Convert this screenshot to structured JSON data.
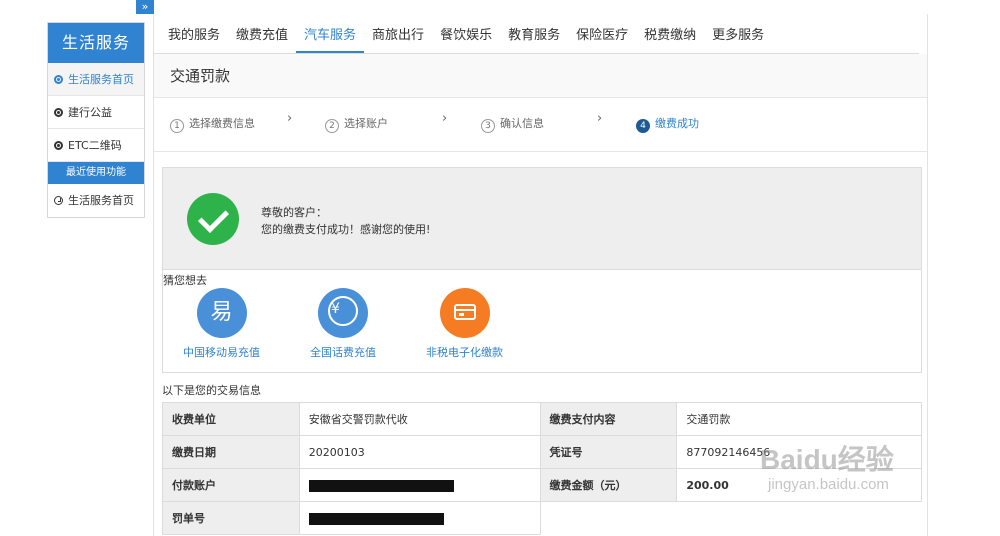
{
  "expand_toggle": "»",
  "sidebar": {
    "title": "生活服务",
    "items": [
      {
        "label": "生活服务首页",
        "icon": "dot-circle-icon",
        "active": true
      },
      {
        "label": "建行公益",
        "icon": "dot-circle-icon",
        "active": false
      },
      {
        "label": "ETC二维码",
        "icon": "dot-circle-icon",
        "active": false
      }
    ],
    "recent_header": "最近使用功能",
    "recent_items": [
      {
        "label": "生活服务首页",
        "icon": "clock-icon"
      }
    ]
  },
  "tabs": [
    {
      "label": "我的服务",
      "active": false
    },
    {
      "label": "缴费充值",
      "active": false
    },
    {
      "label": "汽车服务",
      "active": true
    },
    {
      "label": "商旅出行",
      "active": false
    },
    {
      "label": "餐饮娱乐",
      "active": false
    },
    {
      "label": "教育服务",
      "active": false
    },
    {
      "label": "保险医疗",
      "active": false
    },
    {
      "label": "税费缴纳",
      "active": false
    },
    {
      "label": "更多服务",
      "active": false
    }
  ],
  "page_title": "交通罚款",
  "steps": [
    {
      "num": "1",
      "label": "选择缴费信息",
      "current": false
    },
    {
      "num": "2",
      "label": "选择账户",
      "current": false
    },
    {
      "num": "3",
      "label": "确认信息",
      "current": false
    },
    {
      "num": "4",
      "label": "缴费成功",
      "current": true
    }
  ],
  "step_separator": "›",
  "success": {
    "icon": "check-circle-icon",
    "greeting": "尊敬的客户：",
    "message": "您的缴费支付成功！感谢您的使用!"
  },
  "suggest": {
    "title": "猜您想去",
    "items": [
      {
        "label": "中国移动易充值",
        "glyph": "易",
        "icon": "yi-recharge-icon",
        "color": "#4a90d9"
      },
      {
        "label": "全国话费充值",
        "glyph": "¥",
        "icon": "phone-bill-icon",
        "color": "#4a90d9"
      },
      {
        "label": "非税电子化缴款",
        "glyph": "",
        "icon": "card-payment-icon",
        "color": "#f57c23"
      }
    ]
  },
  "transaction": {
    "title": "以下是您的交易信息",
    "rows": [
      {
        "label1": "收费单位",
        "value1": "安徽省交警罚款代收",
        "label2": "缴费支付内容",
        "value2": "交通罚款"
      },
      {
        "label1": "缴费日期",
        "value1": "20200103",
        "label2": "凭证号",
        "value2": "877092146456"
      },
      {
        "label1": "付款账户",
        "value1": "",
        "label2": "缴费金额（元）",
        "value2": "200.00"
      },
      {
        "label1": "罚单号",
        "value1": "",
        "label2": "",
        "value2": ""
      }
    ]
  },
  "watermark": {
    "main": "Baidu经验",
    "sub": "jingyan.baidu.com"
  }
}
